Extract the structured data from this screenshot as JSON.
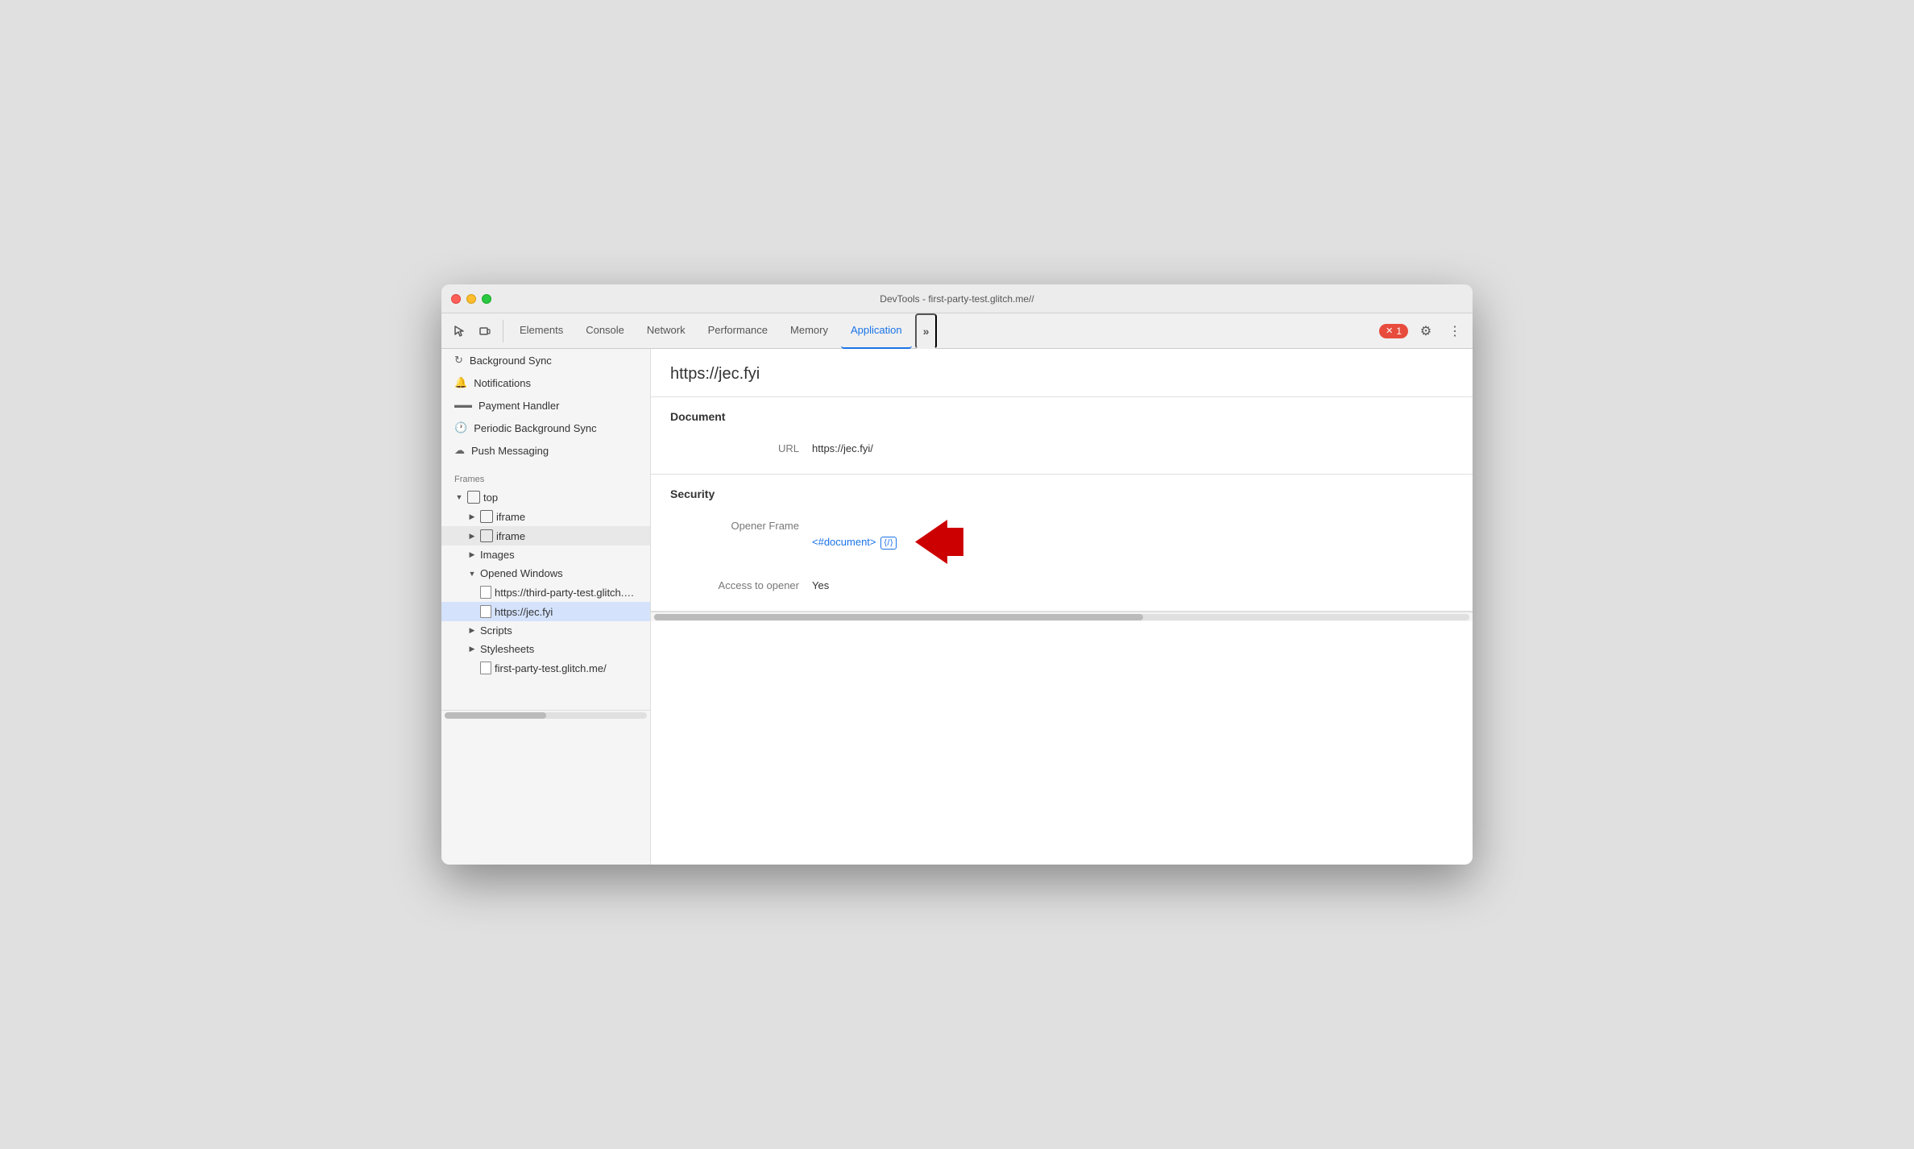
{
  "window": {
    "title": "DevTools - first-party-test.glitch.me//"
  },
  "toolbar": {
    "tabs": [
      {
        "id": "elements",
        "label": "Elements",
        "active": false
      },
      {
        "id": "console",
        "label": "Console",
        "active": false
      },
      {
        "id": "network",
        "label": "Network",
        "active": false
      },
      {
        "id": "performance",
        "label": "Performance",
        "active": false
      },
      {
        "id": "memory",
        "label": "Memory",
        "active": false
      },
      {
        "id": "application",
        "label": "Application",
        "active": true
      }
    ],
    "more_label": "»",
    "error_count": "1",
    "gear_icon": "⚙",
    "more_icon": "⋮"
  },
  "sidebar": {
    "service_worker_items": [
      {
        "id": "background-sync",
        "label": "Background Sync",
        "icon": "↻"
      },
      {
        "id": "notifications",
        "label": "Notifications",
        "icon": "🔔"
      },
      {
        "id": "payment-handler",
        "label": "Payment Handler",
        "icon": "💳"
      },
      {
        "id": "periodic-background-sync",
        "label": "Periodic Background Sync",
        "icon": "⏰"
      },
      {
        "id": "push-messaging",
        "label": "Push Messaging",
        "icon": "☁"
      }
    ],
    "frames_section": "Frames",
    "frames_tree": [
      {
        "id": "top",
        "label": "top",
        "indent": 0,
        "expanded": true,
        "type": "frame",
        "has_expand": true
      },
      {
        "id": "iframe1",
        "label": "iframe",
        "indent": 1,
        "expanded": false,
        "type": "frame",
        "has_expand": true
      },
      {
        "id": "iframe2",
        "label": "iframe",
        "indent": 1,
        "expanded": false,
        "type": "frame",
        "has_expand": true,
        "selected": false
      },
      {
        "id": "images",
        "label": "Images",
        "indent": 1,
        "expanded": false,
        "type": "folder",
        "has_expand": true
      },
      {
        "id": "opened-windows",
        "label": "Opened Windows",
        "indent": 1,
        "expanded": true,
        "type": "folder",
        "has_expand": true
      },
      {
        "id": "third-party-url",
        "label": "https://third-party-test.glitch.me/po",
        "indent": 2,
        "type": "page"
      },
      {
        "id": "jec-fyi",
        "label": "https://jec.fyi",
        "indent": 2,
        "type": "page",
        "selected": true
      },
      {
        "id": "scripts",
        "label": "Scripts",
        "indent": 1,
        "expanded": false,
        "type": "folder",
        "has_expand": true
      },
      {
        "id": "stylesheets",
        "label": "Stylesheets",
        "indent": 1,
        "expanded": false,
        "type": "folder",
        "has_expand": true
      },
      {
        "id": "first-party-file",
        "label": "first-party-test.glitch.me/",
        "indent": 2,
        "type": "page"
      }
    ]
  },
  "main_panel": {
    "url": "https://jec.fyi",
    "document_section_title": "Document",
    "url_label": "URL",
    "url_value": "https://jec.fyi/",
    "security_section_title": "Security",
    "opener_frame_label": "Opener Frame",
    "opener_frame_link": "<#document>",
    "opener_frame_link_icon": "⟨/⟩",
    "access_to_opener_label": "Access to opener",
    "access_to_opener_value": "Yes"
  },
  "colors": {
    "active_tab_color": "#1a73e8",
    "selected_bg": "#d4e2fc",
    "link_color": "#1a73e8",
    "error_badge_bg": "#e74c3c",
    "red_arrow": "#cc0000"
  }
}
